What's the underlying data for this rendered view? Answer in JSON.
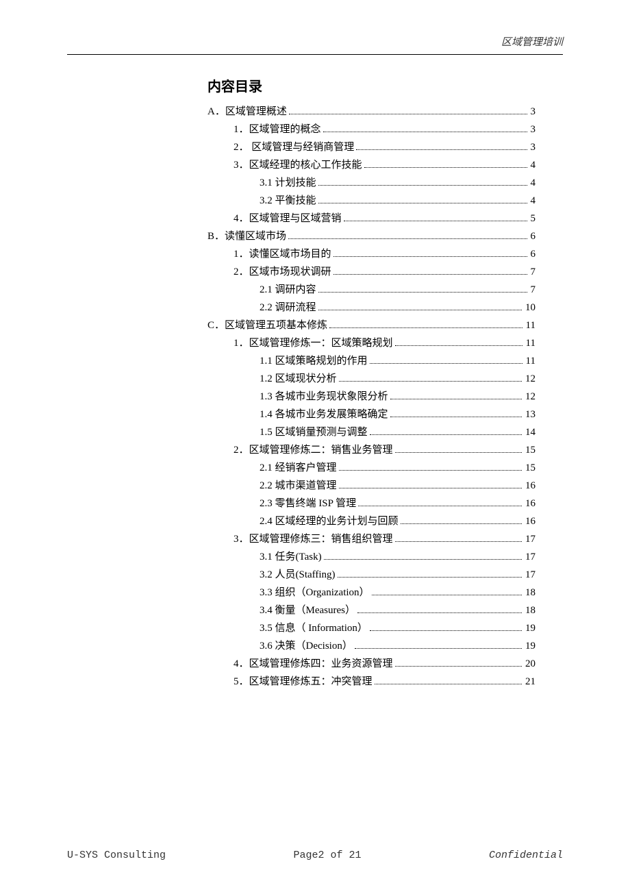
{
  "header": {
    "right_text": "区域管理培训"
  },
  "toc_title": "内容目录",
  "toc": [
    {
      "level": 0,
      "label": "A．区域管理概述",
      "page": "3"
    },
    {
      "level": 1,
      "label": "1．区域管理的概念",
      "page": "3"
    },
    {
      "level": 1,
      "label": "2． 区域管理与经销商管理",
      "page": "3"
    },
    {
      "level": 1,
      "label": "3．区域经理的核心工作技能",
      "page": "4"
    },
    {
      "level": 2,
      "label": "3.1 计划技能",
      "page": "4"
    },
    {
      "level": 2,
      "label": "3.2 平衡技能",
      "page": "4"
    },
    {
      "level": 1,
      "label": "4．区域管理与区域营销",
      "page": "5"
    },
    {
      "level": 0,
      "label": "B．读懂区域市场",
      "page": "6"
    },
    {
      "level": 1,
      "label": "1．读懂区域市场目的",
      "page": "6"
    },
    {
      "level": 1,
      "label": "2．区域市场现状调研",
      "page": "7"
    },
    {
      "level": 2,
      "label": "2.1 调研内容",
      "page": "7"
    },
    {
      "level": 2,
      "label": "2.2 调研流程",
      "page": "10"
    },
    {
      "level": 0,
      "label": "C．区域管理五项基本修炼",
      "page": "11"
    },
    {
      "level": 1,
      "label": "1．区域管理修炼一：区域策略规划",
      "page": "11"
    },
    {
      "level": 2,
      "label": "1.1 区域策略规划的作用",
      "page": "11"
    },
    {
      "level": 2,
      "label": "1.2 区域现状分析",
      "page": "12"
    },
    {
      "level": 2,
      "label": "1.3 各城市业务现状象限分析",
      "page": "12"
    },
    {
      "level": 2,
      "label": "1.4 各城市业务发展策略确定",
      "page": "13"
    },
    {
      "level": 2,
      "label": "1.5 区域销量预测与调整",
      "page": "14"
    },
    {
      "level": 1,
      "label": "2．区域管理修炼二：销售业务管理",
      "page": "15"
    },
    {
      "level": 2,
      "label": "2.1 经销客户管理",
      "page": "15"
    },
    {
      "level": 2,
      "label": "2.2 城市渠道管理",
      "page": "16"
    },
    {
      "level": 2,
      "label": "2.3 零售终端 ISP 管理",
      "page": "16"
    },
    {
      "level": 2,
      "label": "2.4 区域经理的业务计划与回顾",
      "page": "16"
    },
    {
      "level": 1,
      "label": "3．区域管理修炼三：销售组织管理",
      "page": "17"
    },
    {
      "level": 2,
      "label": "3.1 任务(Task)",
      "page": "17"
    },
    {
      "level": 2,
      "label": "3.2 人员(Staffing)",
      "page": "17"
    },
    {
      "level": 2,
      "label": "3.3 组织（Organization）",
      "page": "18"
    },
    {
      "level": 2,
      "label": "3.4 衡量（Measures）",
      "page": "18"
    },
    {
      "level": 2,
      "label": "3.5 信息（ Information）",
      "page": "19"
    },
    {
      "level": 2,
      "label": "3.6 决策（Decision）",
      "page": "19"
    },
    {
      "level": 1,
      "label": "4．区域管理修炼四：业务资源管理",
      "page": "20"
    },
    {
      "level": 1,
      "label": "5．区域管理修炼五：冲突管理",
      "page": "21"
    }
  ],
  "footer": {
    "left": "U-SYS Consulting",
    "center": "Page2 of 21",
    "right": "Confidential"
  }
}
